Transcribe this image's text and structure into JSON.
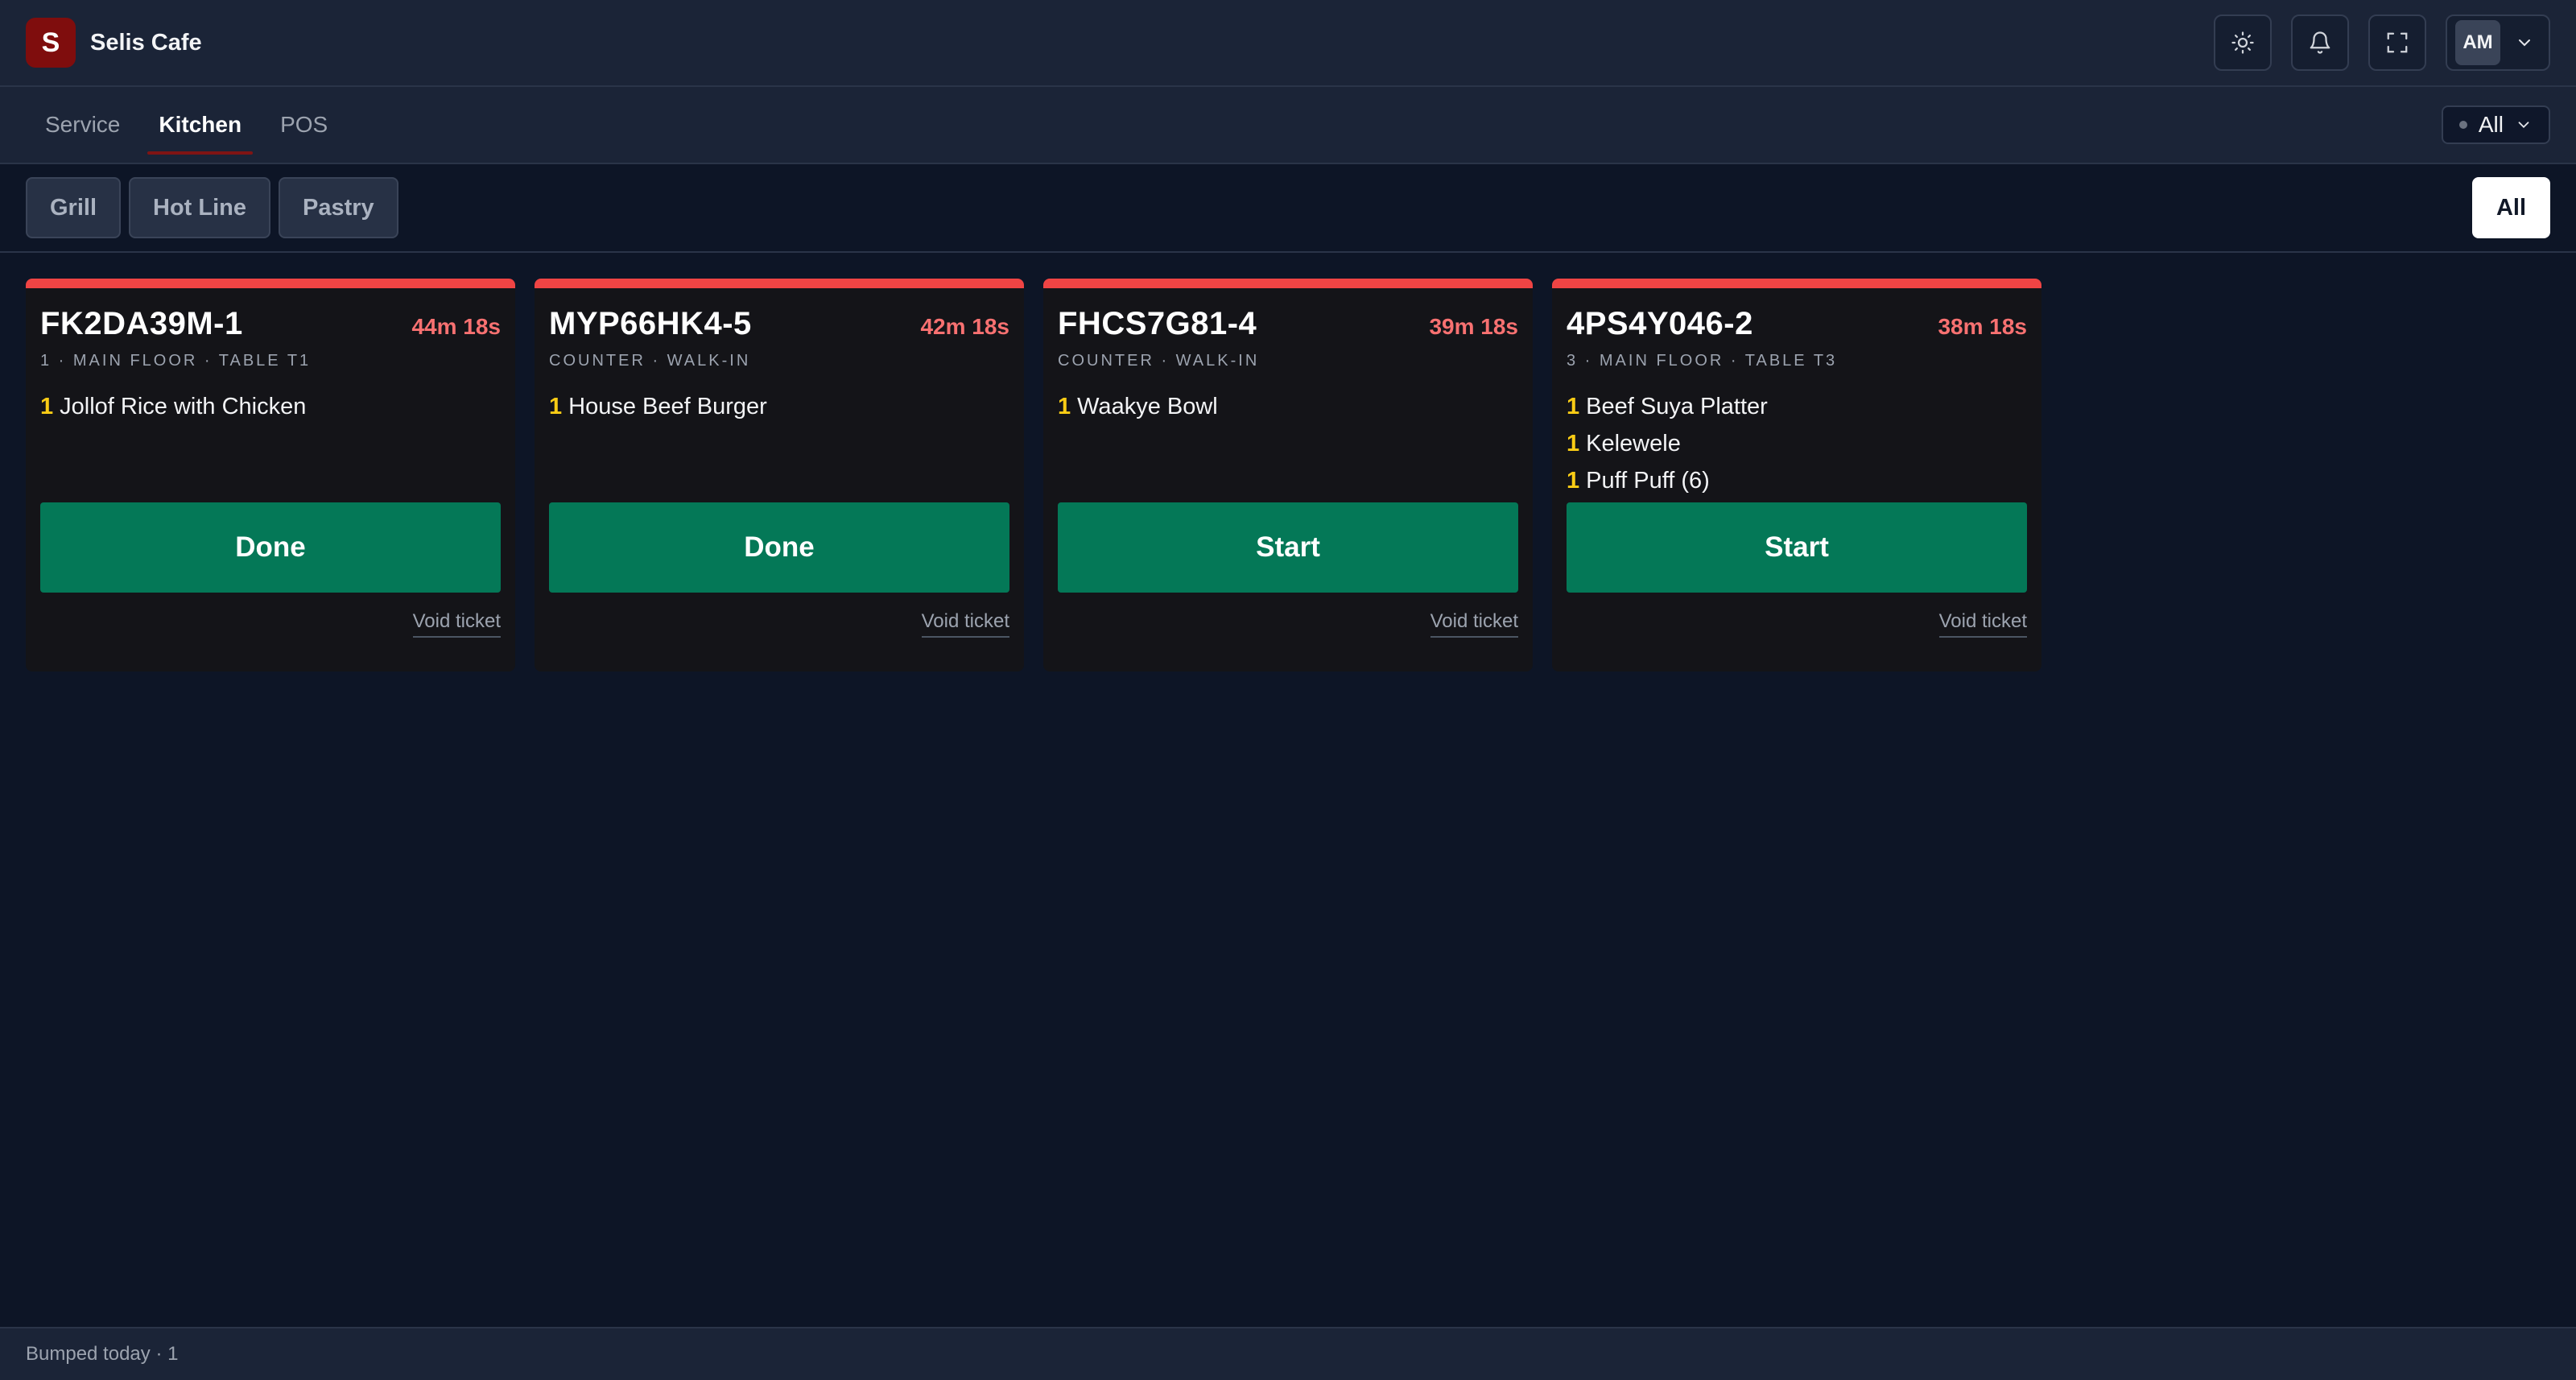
{
  "header": {
    "logo_letter": "S",
    "brand_name": "Selis Cafe",
    "user_initials": "AM",
    "icons": [
      "sun-icon",
      "bell-icon",
      "fullscreen-icon",
      "chevron-down-icon"
    ]
  },
  "nav": {
    "tabs": [
      {
        "label": "Service",
        "active": false
      },
      {
        "label": "Kitchen",
        "active": true
      },
      {
        "label": "POS",
        "active": false
      }
    ],
    "filter_value": "All"
  },
  "stations": {
    "items": [
      "Grill",
      "Hot Line",
      "Pastry"
    ],
    "all_label": "All"
  },
  "tickets": [
    {
      "id": "FK2DA39M-1",
      "timer": "44m 18s",
      "meta": "1 · MAIN FLOOR · TABLE T1",
      "items": [
        {
          "qty": "1",
          "name": "Jollof Rice with Chicken"
        }
      ],
      "action": "Done",
      "void": "Void ticket"
    },
    {
      "id": "MYP66HK4-5",
      "timer": "42m 18s",
      "meta": "COUNTER · WALK-IN",
      "items": [
        {
          "qty": "1",
          "name": "House Beef Burger"
        }
      ],
      "action": "Done",
      "void": "Void ticket"
    },
    {
      "id": "FHCS7G81-4",
      "timer": "39m 18s",
      "meta": "COUNTER · WALK-IN",
      "items": [
        {
          "qty": "1",
          "name": "Waakye Bowl"
        }
      ],
      "action": "Start",
      "void": "Void ticket"
    },
    {
      "id": "4PS4Y046-2",
      "timer": "38m 18s",
      "meta": "3 · MAIN FLOOR · TABLE T3",
      "items": [
        {
          "qty": "1",
          "name": "Beef Suya Platter"
        },
        {
          "qty": "1",
          "name": "Kelewele"
        },
        {
          "qty": "1",
          "name": "Puff Puff (6)"
        }
      ],
      "action": "Start",
      "void": "Void ticket"
    }
  ],
  "footer": {
    "status": "Bumped today · 1"
  },
  "colors": {
    "accent_red": "#ef4444",
    "action_green": "#047857",
    "qty_yellow": "#facc15",
    "brand_red": "#7f0d0d"
  }
}
